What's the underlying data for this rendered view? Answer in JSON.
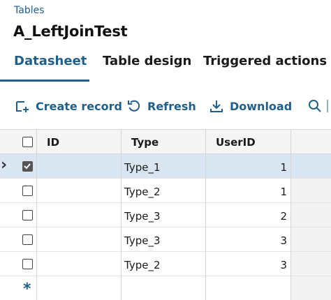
{
  "breadcrumb": "Tables",
  "title": "A_LeftJoinTest",
  "tabs": [
    {
      "label": "Datasheet",
      "active": true
    },
    {
      "label": "Table design",
      "active": false
    },
    {
      "label": "Triggered actions",
      "active": false
    }
  ],
  "toolbar": {
    "create_label": "Create record",
    "refresh_label": "Refresh",
    "download_label": "Download"
  },
  "grid": {
    "columns": [
      "ID",
      "Type",
      "UserID"
    ],
    "rows": [
      {
        "id": "",
        "type": "Type_1",
        "user_id": "1",
        "selected": true,
        "checked": true
      },
      {
        "id": "",
        "type": "Type_2",
        "user_id": "1",
        "selected": false,
        "checked": false
      },
      {
        "id": "",
        "type": "Type_3",
        "user_id": "2",
        "selected": false,
        "checked": false
      },
      {
        "id": "",
        "type": "Type_3",
        "user_id": "3",
        "selected": false,
        "checked": false
      },
      {
        "id": "",
        "type": "Type_2",
        "user_id": "3",
        "selected": false,
        "checked": false
      }
    ],
    "new_row_marker": "*"
  },
  "colors": {
    "accent": "#1f5f8b",
    "selected_row": "#d9e6f2",
    "header_bg": "#f5f5f5"
  }
}
